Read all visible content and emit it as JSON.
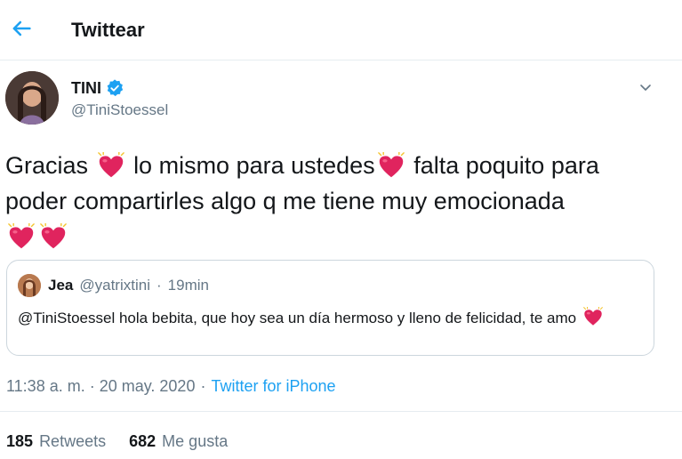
{
  "header": {
    "back_icon": "arrow-left-icon",
    "title": "Twittear"
  },
  "tweet": {
    "author_name": "TINI",
    "author_handle": "@TiniStoessel",
    "verified": true,
    "text_parts": [
      "Gracias",
      "lo mismo para ustedes",
      "falta poquito para poder compartirles algo q me tiene muy emocionada"
    ],
    "emoji": "sparkling-heart-icon"
  },
  "quoted_tweet": {
    "author_name": "Jea",
    "author_handle": "@yatrixtini",
    "separator": "·",
    "time": "19min",
    "text": "@TiniStoessel hola bebita, que hoy sea un día hermoso y lleno de felicidad, te amo"
  },
  "meta": {
    "timestamp": "11:38 a. m. · 20 may. 2020",
    "separator": "·",
    "source": "Twitter for iPhone"
  },
  "stats": {
    "retweets_count": "185",
    "retweets_label": "Retweets",
    "likes_count": "682",
    "likes_label": "Me gusta"
  },
  "colors": {
    "accent": "#1da1f2",
    "secondary_text": "#657786",
    "heart": "#e0245e"
  }
}
